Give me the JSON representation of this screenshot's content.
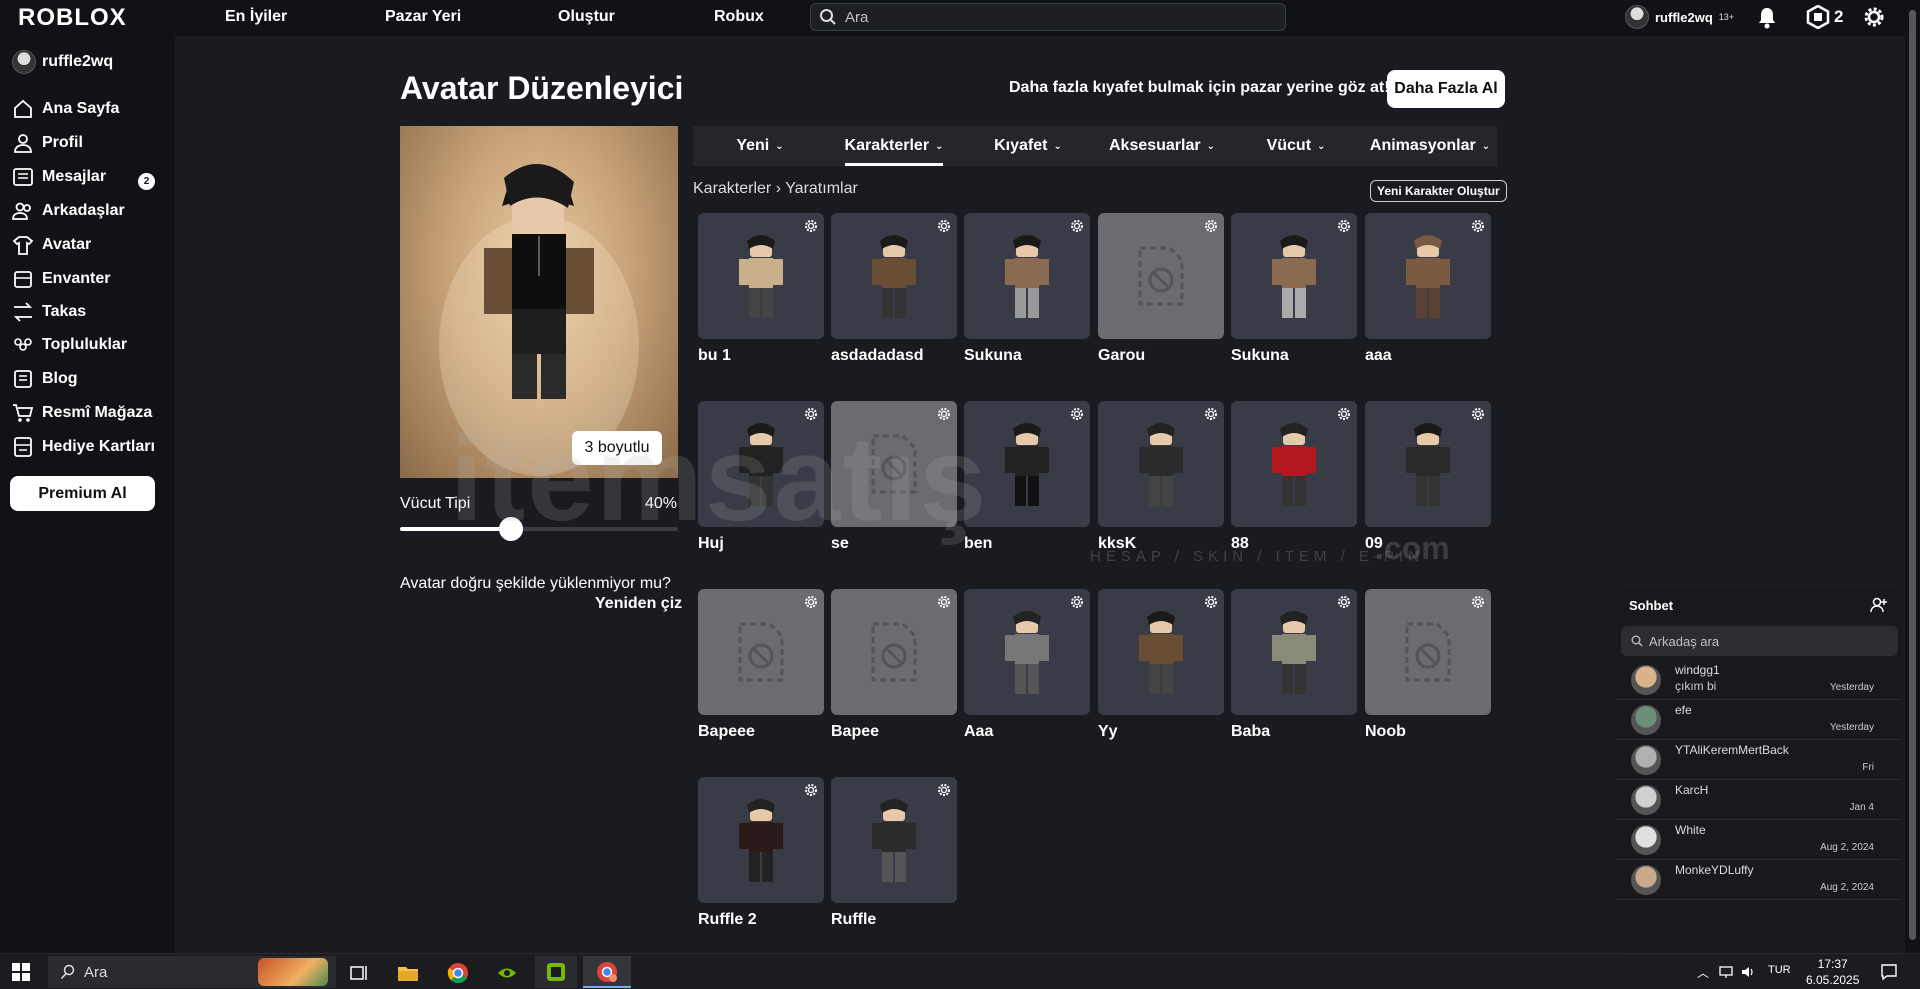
{
  "topbar": {
    "logo": "ROBLOX",
    "nav": [
      "En İyiler",
      "Pazar Yeri",
      "Oluştur",
      "Robux"
    ],
    "search_placeholder": "Ara",
    "username": "ruffle2wq",
    "age_label": "13+",
    "robux": "2"
  },
  "sidebar": {
    "username": "ruffle2wq",
    "items": [
      {
        "label": "Ana Sayfa",
        "icon": "home-icon"
      },
      {
        "label": "Profil",
        "icon": "profile-icon"
      },
      {
        "label": "Mesajlar",
        "icon": "messages-icon",
        "badge": "2"
      },
      {
        "label": "Arkadaşlar",
        "icon": "friends-icon"
      },
      {
        "label": "Avatar",
        "icon": "avatar-icon"
      },
      {
        "label": "Envanter",
        "icon": "inventory-icon"
      },
      {
        "label": "Takas",
        "icon": "trade-icon"
      },
      {
        "label": "Topluluklar",
        "icon": "communities-icon"
      },
      {
        "label": "Blog",
        "icon": "blog-icon"
      },
      {
        "label": "Resmî Mağaza",
        "icon": "store-icon"
      },
      {
        "label": "Hediye Kartları",
        "icon": "gift-card-icon"
      }
    ],
    "premium_label": "Premium Al"
  },
  "editor": {
    "title": "Avatar Düzenleyici",
    "promo_text": "Daha fazla kıyafet bulmak için pazar yerine göz at!",
    "more_button": "Daha Fazla Al",
    "view_3d_button": "3 boyutlu",
    "body_type_label": "Vücut Tipi",
    "body_type_value": "40%",
    "body_type_fraction": 0.4,
    "warning_text": "Avatar doğru şekilde yüklenmiyor mu?",
    "redraw_link": "Yeniden çiz",
    "tabs": [
      "Yeni",
      "Karakterler",
      "Kıyafet",
      "Aksesuarlar",
      "Vücut",
      "Animasyonlar"
    ],
    "active_tab": "Karakterler",
    "breadcrumb": [
      "Karakterler",
      "Yaratımlar"
    ],
    "new_character_button": "Yeni Karakter Oluştur",
    "characters": [
      {
        "name": "bu 1",
        "has_image": true
      },
      {
        "name": "asdadadasd",
        "has_image": true
      },
      {
        "name": "Sukuna",
        "has_image": true
      },
      {
        "name": "Garou",
        "has_image": false
      },
      {
        "name": "Sukuna",
        "has_image": true
      },
      {
        "name": "aaa",
        "has_image": true
      },
      {
        "name": "Huj",
        "has_image": true
      },
      {
        "name": "se",
        "has_image": false
      },
      {
        "name": "ben",
        "has_image": true
      },
      {
        "name": "kksK",
        "has_image": true
      },
      {
        "name": "88",
        "has_image": true
      },
      {
        "name": "09",
        "has_image": true
      },
      {
        "name": "Bapeee",
        "has_image": false
      },
      {
        "name": "Bapee",
        "has_image": false
      },
      {
        "name": "Aaa",
        "has_image": true
      },
      {
        "name": "Yy",
        "has_image": true
      },
      {
        "name": "Baba",
        "has_image": true
      },
      {
        "name": "Noob",
        "has_image": false
      },
      {
        "name": "Ruffle 2",
        "has_image": true
      },
      {
        "name": "Ruffle",
        "has_image": true
      }
    ]
  },
  "chat": {
    "title": "Sohbet",
    "search_placeholder": "Arkadaş ara",
    "conversations": [
      {
        "name": "windgg1",
        "message": "çıkım bi",
        "time": "Yesterday"
      },
      {
        "name": "efe",
        "message": "",
        "time": "Yesterday"
      },
      {
        "name": "YTAliKeremMertBack",
        "message": "",
        "time": "Fri"
      },
      {
        "name": "KarcH",
        "message": "",
        "time": "Jan 4"
      },
      {
        "name": "White",
        "message": "",
        "time": "Aug 2, 2024"
      },
      {
        "name": "MonkeYDLuffy",
        "message": "",
        "time": "Aug 2, 2024"
      }
    ]
  },
  "watermark": {
    "text": "itemsatış",
    "subtitle": "HESAP / SKIN / ITEM / E-PIN",
    "suffix": ".com"
  },
  "taskbar": {
    "search_placeholder": "Ara",
    "language": "TUR",
    "time": "17:37",
    "date": "6.05.2025"
  }
}
